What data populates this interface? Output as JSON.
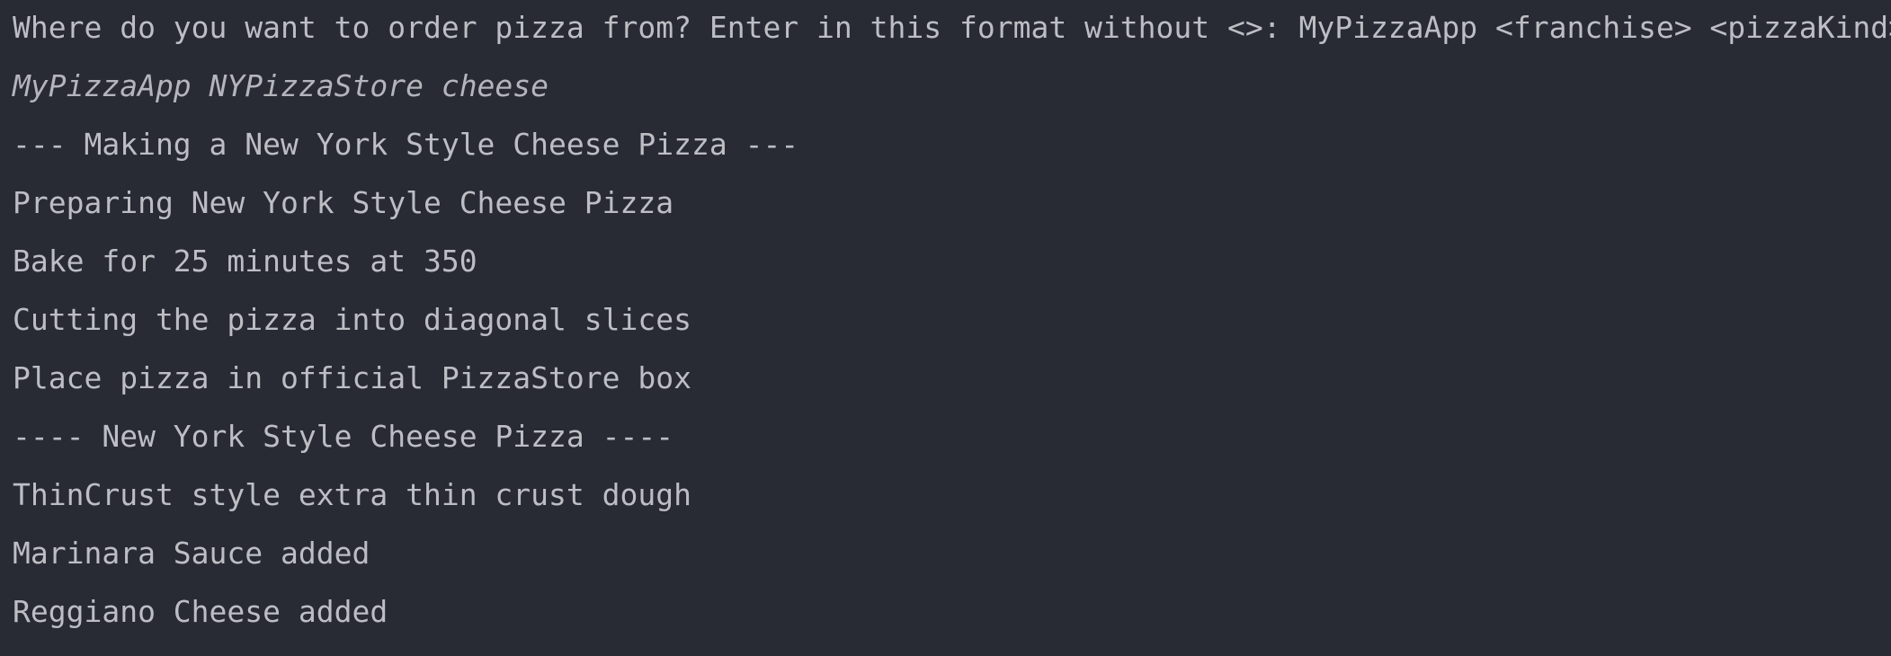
{
  "console": {
    "prompt": "Where do you want to order pizza from? Enter in this format without <>: MyPizzaApp <franchise> <pizzaKind>",
    "user_input": "MyPizzaApp NYPizzaStore cheese",
    "output": [
      "--- Making a New York Style Cheese Pizza ---",
      "Preparing New York Style Cheese Pizza",
      "Bake for 25 minutes at 350",
      "Cutting the pizza into diagonal slices",
      "Place pizza in official PizzaStore box",
      "---- New York Style Cheese Pizza ----",
      "ThinCrust style extra thin crust dough",
      "Marinara Sauce added",
      "Reggiano Cheese added"
    ]
  },
  "colors": {
    "background": "#282a34",
    "text": "#bcbec4"
  }
}
